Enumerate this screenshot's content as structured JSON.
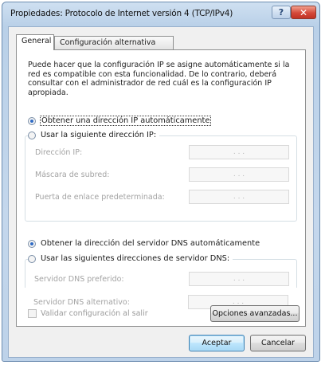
{
  "window": {
    "title": "Propiedades: Protocolo de Internet versión 4 (TCP/IPv4)",
    "help_label": "?",
    "close_label": "✕"
  },
  "tabs": [
    {
      "label": "General",
      "active": true
    },
    {
      "label": "Configuración alternativa",
      "active": false
    }
  ],
  "description": "Puede hacer que la configuración IP se asigne automáticamente si la red es compatible con esta funcionalidad. De lo contrario, deberá consultar con el administrador de red cuál es la configuración IP apropiada.",
  "ip_mode": {
    "auto_label": "Obtener una dirección IP automáticamente",
    "auto_selected": true,
    "manual_label": "Usar la siguiente dirección IP:",
    "manual_selected": false
  },
  "ip_fields": [
    {
      "label": "Dirección IP:",
      "value": ". . ."
    },
    {
      "label": "Máscara de subred:",
      "value": ". . ."
    },
    {
      "label": "Puerta de enlace predeterminada:",
      "value": ". . ."
    }
  ],
  "dns_mode": {
    "auto_label": "Obtener la dirección del servidor DNS automáticamente",
    "auto_selected": true,
    "manual_label": "Usar las siguientes direcciones de servidor DNS:",
    "manual_selected": false
  },
  "dns_fields": [
    {
      "label": "Servidor DNS preferido:",
      "value": ". . ."
    },
    {
      "label": "Servidor DNS alternativo:",
      "value": ". . ."
    }
  ],
  "validate": {
    "label": "Validar configuración al salir",
    "checked": false
  },
  "buttons": {
    "advanced": "Opciones avanzadas...",
    "ok": "Aceptar",
    "cancel": "Cancelar"
  },
  "colors": {
    "title_bar": "#c4d7ec",
    "radio_selected": "#2f6bc5",
    "close_button": "#d4493a"
  }
}
